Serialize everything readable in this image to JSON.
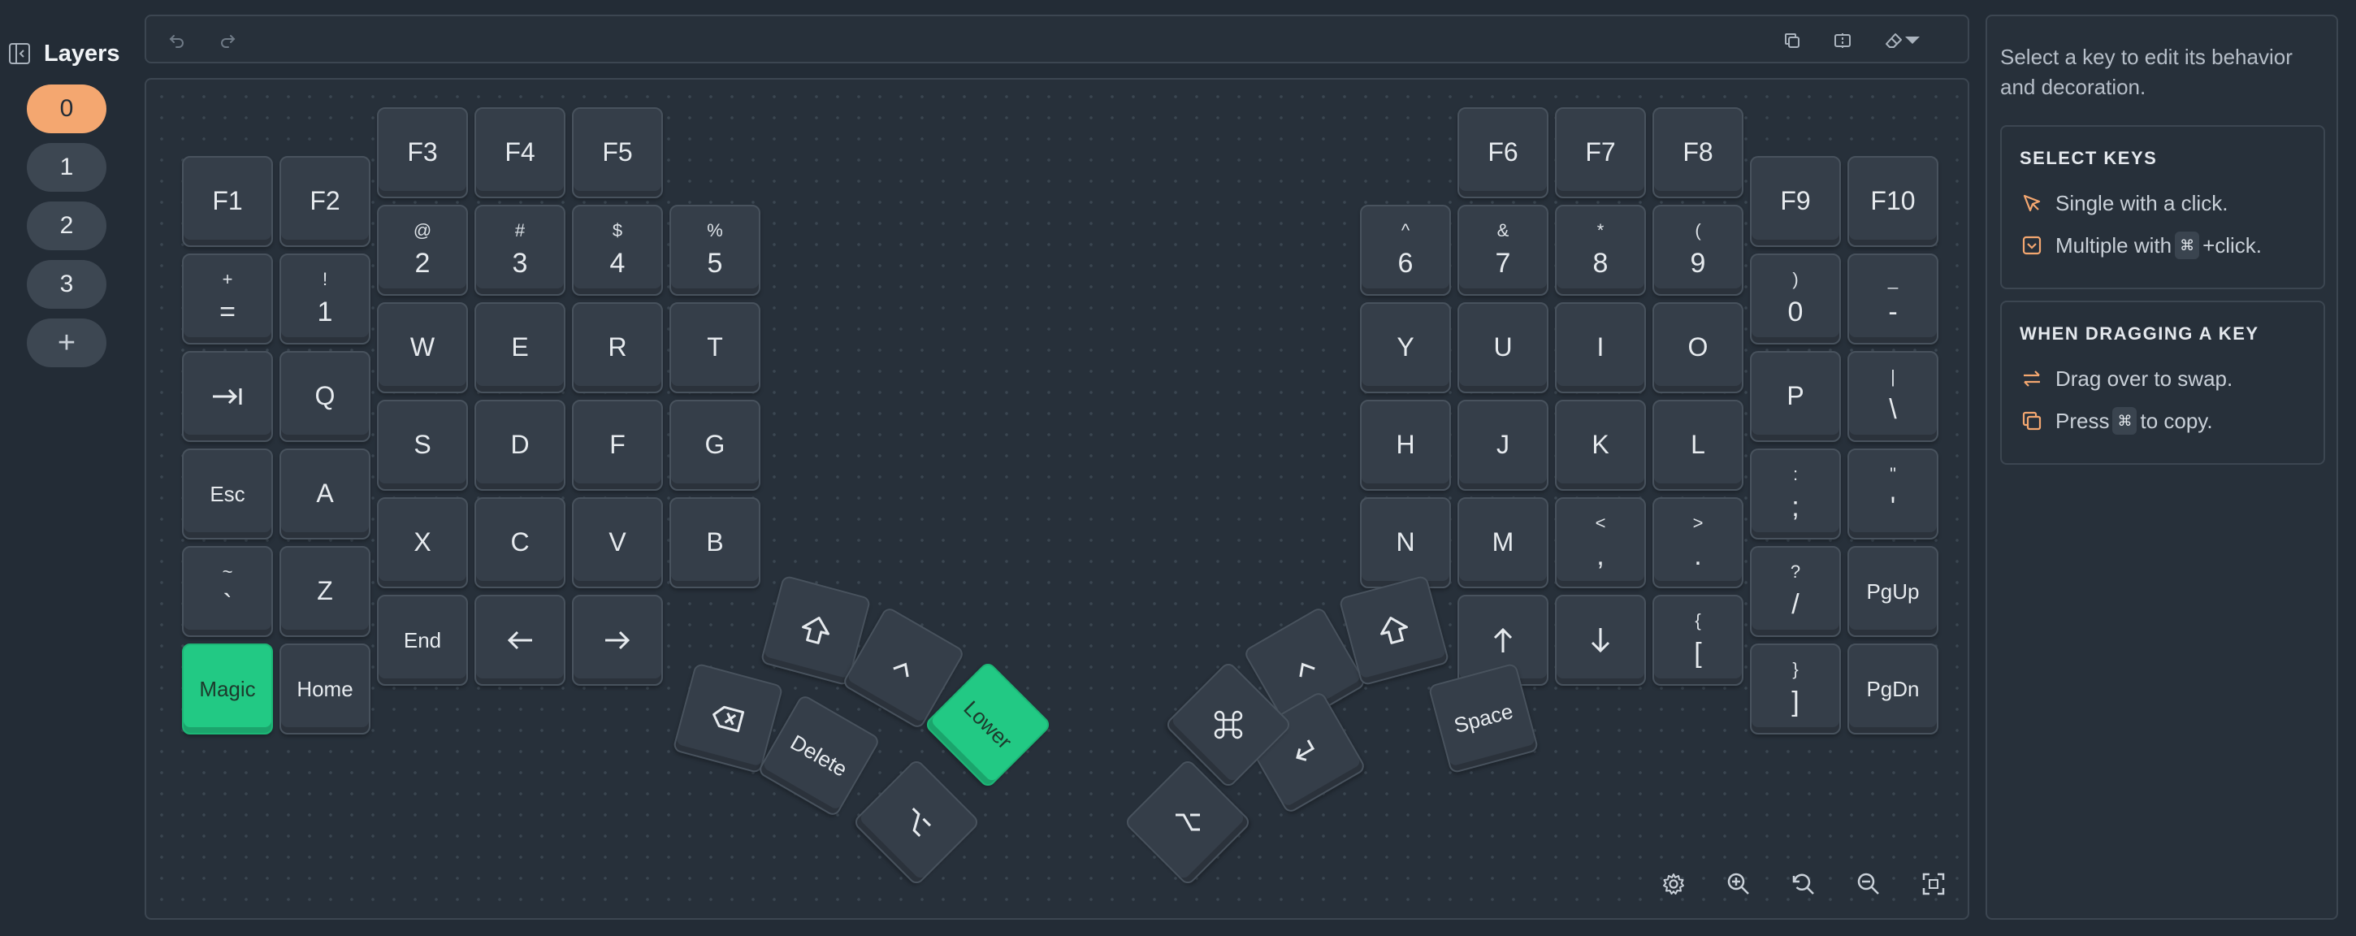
{
  "sidebar": {
    "title": "Layers",
    "layers": [
      "0",
      "1",
      "2",
      "3"
    ],
    "add_label": "+"
  },
  "colors": {
    "accent_orange": "#f4a770",
    "accent_green": "#22c984",
    "background": "#232c36"
  },
  "keys": {
    "f1": "F1",
    "f2": "F2",
    "f3": "F3",
    "f4": "F4",
    "f5": "F5",
    "f6": "F6",
    "f7": "F7",
    "f8": "F8",
    "f9": "F9",
    "f10": "F10",
    "equal": {
      "shift": "+",
      "base": "="
    },
    "n1": {
      "shift": "!",
      "base": "1"
    },
    "n2": {
      "shift": "@",
      "base": "2"
    },
    "n3": {
      "shift": "#",
      "base": "3"
    },
    "n4": {
      "shift": "$",
      "base": "4"
    },
    "n5": {
      "shift": "%",
      "base": "5"
    },
    "n6": {
      "shift": "^",
      "base": "6"
    },
    "n7": {
      "shift": "&",
      "base": "7"
    },
    "n8": {
      "shift": "*",
      "base": "8"
    },
    "n9": {
      "shift": "(",
      "base": "9"
    },
    "n0": {
      "shift": ")",
      "base": "0"
    },
    "minus": {
      "shift": "_",
      "base": "-"
    },
    "w": "W",
    "e": "E",
    "r": "R",
    "t": "T",
    "q": "Q",
    "y": "Y",
    "u": "U",
    "i": "I",
    "o": "O",
    "p": "P",
    "backslash": {
      "shift": "|",
      "base": "\\"
    },
    "esc": "Esc",
    "a": "A",
    "s": "S",
    "d": "D",
    "f": "F",
    "g": "G",
    "h": "H",
    "j": "J",
    "k": "K",
    "l": "L",
    "semicolon": {
      "shift": ":",
      "base": ";"
    },
    "quote": {
      "shift": "\"",
      "base": "'"
    },
    "grave": {
      "shift": "~",
      "base": "`"
    },
    "z": "Z",
    "x": "X",
    "c": "C",
    "v": "V",
    "b": "B",
    "n": "N",
    "m": "M",
    "comma": {
      "shift": "<",
      "base": ","
    },
    "period": {
      "shift": ">",
      "base": "."
    },
    "slash": {
      "shift": "?",
      "base": "/"
    },
    "pgup": "PgUp",
    "magic": "Magic",
    "home": "Home",
    "end": "End",
    "lbracket": {
      "shift": "{",
      "base": "["
    },
    "rbracket": {
      "shift": "}",
      "base": "]"
    },
    "pgdn": "PgDn",
    "delete": "Delete",
    "lower": "Lower",
    "space": "Space"
  },
  "help": {
    "intro": "Select a key to edit its behavior and decoration.",
    "select_title": "SELECT KEYS",
    "select_single": "Single with a click.",
    "select_multi_prefix": "Multiple with",
    "select_multi_key": "⌘",
    "select_multi_suffix": "+click.",
    "drag_title": "WHEN DRAGGING A KEY",
    "drag_swap": "Drag over to swap.",
    "drag_copy_prefix": "Press",
    "drag_copy_key": "⌘",
    "drag_copy_suffix": "to copy."
  }
}
